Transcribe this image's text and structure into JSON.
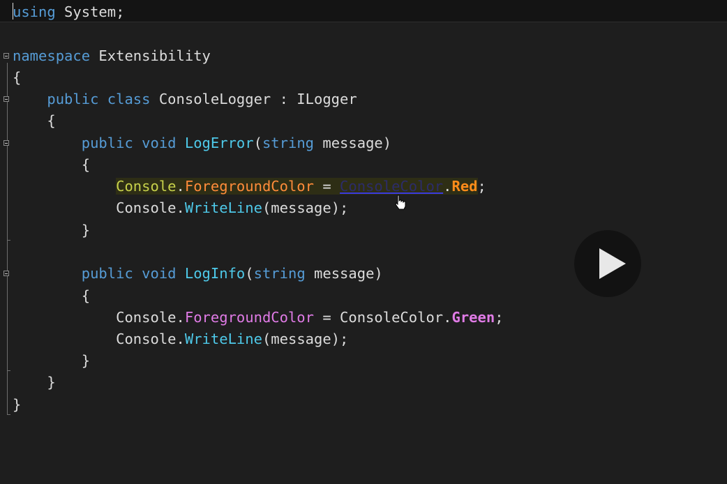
{
  "editor": {
    "lines": {
      "l1": {
        "kw": "using",
        "rest": " System;"
      },
      "l3": {
        "kw": "namespace",
        "rest": " Extensibility"
      },
      "l4": {
        "text": "{"
      },
      "l5": {
        "indent": "    ",
        "kw": "public class",
        "rest": " ConsoleLogger : ILogger"
      },
      "l6": {
        "text": "    {"
      },
      "l7": {
        "indent": "        ",
        "kw": "public void",
        "method": " LogError",
        "open": "(",
        "kw2": "string",
        "rest": " message)"
      },
      "l8": {
        "text": "        {"
      },
      "l9": {
        "indent": "            ",
        "cls": "Console",
        "dot1": ".",
        "prop": "ForegroundColor",
        "eq": " = ",
        "type": "ConsoleColor",
        "dot2": ".",
        "enum": "Red",
        "end": ";"
      },
      "l10": {
        "indent": "            ",
        "cls": "Console",
        "dot1": ".",
        "method": "WriteLine",
        "rest": "(message);"
      },
      "l11": {
        "text": "        }"
      },
      "l13": {
        "indent": "        ",
        "kw": "public void",
        "method": " LogInfo",
        "open": "(",
        "kw2": "string",
        "rest": " message)"
      },
      "l14": {
        "text": "        {"
      },
      "l15": {
        "indent": "            ",
        "cls": "Console",
        "dot1": ".",
        "prop": "ForegroundColor",
        "eq": " = ",
        "type": "ConsoleColor",
        "dot2": ".",
        "enum": "Green",
        "end": ";"
      },
      "l16": {
        "indent": "            ",
        "cls": "Console",
        "dot1": ".",
        "method": "WriteLine",
        "rest": "(message);"
      },
      "l17": {
        "text": "        }"
      },
      "l18": {
        "text": "    }"
      },
      "l19": {
        "text": "}"
      }
    }
  },
  "overlay": {
    "play_icon": "play-icon",
    "cursor_icon": "hand-cursor-icon"
  },
  "colors": {
    "background": "#1e1e1e",
    "keyword": "#569cd6",
    "method": "#4ec9e9",
    "property": "#ff8c3a",
    "enum_red": "#ff8c1a",
    "enum_green": "#e07be6"
  }
}
